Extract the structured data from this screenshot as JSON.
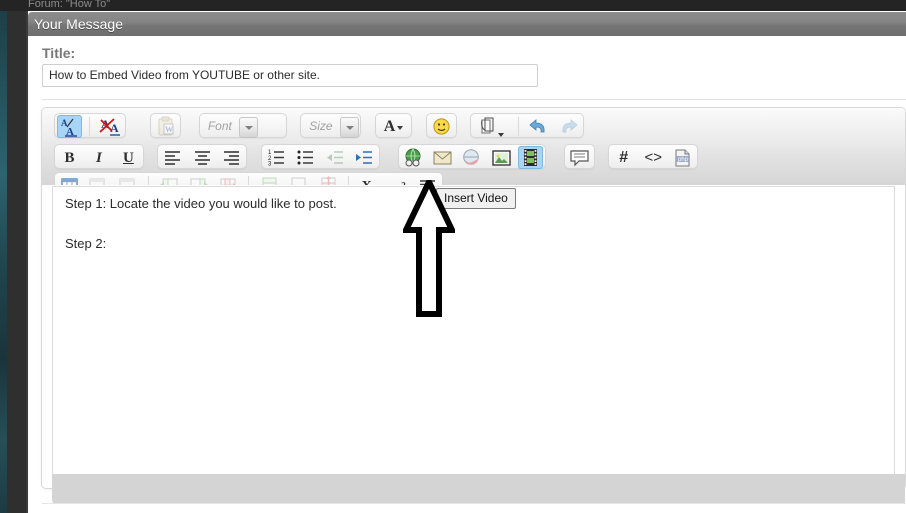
{
  "window": {
    "breadcrumb": "Forum: \"How To\"",
    "panel_header": "Your Message"
  },
  "title_field": {
    "label": "Title:",
    "value": "How to Embed Video from YOUTUBE or other site.",
    "placeholder": ""
  },
  "editor": {
    "body_text": "Step 1: Locate the video you would like to post.\n\nStep 2:",
    "tooltip": "Insert Video",
    "colors": {
      "active_button": "#a8d4f5",
      "toolbar_top": "#fbfbfb",
      "toolbar_bottom": "#d6d6d6",
      "status_bar": "#d4d4d4",
      "header_grey": "#838383",
      "left_rail_teal": "#2c6470",
      "left_rail_dark": "#2f2f2f"
    },
    "toolbar_rows": [
      {
        "row": 1,
        "groups": [
          {
            "items": [
              {
                "name": "spellcheck-icon",
                "glyph": "A/A",
                "state": "active"
              },
              {
                "name": "remove-format-icon",
                "glyph": "A",
                "state": "normal"
              }
            ]
          },
          {
            "items": [
              {
                "name": "paste-from-word-icon",
                "glyph": "W",
                "state": "disabled"
              }
            ]
          },
          {
            "items": [
              {
                "name": "font-family-dropdown",
                "glyph": "Font",
                "state": "disabled"
              }
            ]
          },
          {
            "items": [
              {
                "name": "font-size-dropdown",
                "glyph": "Size",
                "state": "disabled"
              }
            ]
          },
          {
            "items": [
              {
                "name": "text-color-icon",
                "glyph": "A",
                "state": "normal"
              }
            ]
          },
          {
            "items": [
              {
                "name": "emoticon-icon",
                "glyph": "smiley",
                "state": "normal"
              }
            ]
          },
          {
            "items": [
              {
                "name": "attachment-icon",
                "glyph": "clip",
                "state": "normal"
              },
              {
                "name": "undo-icon",
                "glyph": "undo",
                "state": "normal"
              },
              {
                "name": "redo-icon",
                "glyph": "redo",
                "state": "disabled"
              }
            ]
          }
        ]
      },
      {
        "row": 2,
        "groups": [
          {
            "items": [
              {
                "name": "bold-icon",
                "glyph": "B",
                "state": "normal"
              },
              {
                "name": "italic-icon",
                "glyph": "I",
                "state": "normal"
              },
              {
                "name": "underline-icon",
                "glyph": "U",
                "state": "normal"
              }
            ]
          },
          {
            "items": [
              {
                "name": "align-left-icon",
                "glyph": "align-left",
                "state": "normal"
              },
              {
                "name": "align-center-icon",
                "glyph": "align-center",
                "state": "normal"
              },
              {
                "name": "align-right-icon",
                "glyph": "align-right",
                "state": "normal"
              }
            ]
          },
          {
            "items": [
              {
                "name": "ordered-list-icon",
                "glyph": "ol",
                "state": "normal"
              },
              {
                "name": "unordered-list-icon",
                "glyph": "ul",
                "state": "normal"
              },
              {
                "name": "outdent-icon",
                "glyph": "outdent",
                "state": "disabled"
              },
              {
                "name": "indent-icon",
                "glyph": "indent",
                "state": "normal"
              }
            ]
          },
          {
            "items": [
              {
                "name": "insert-link-icon",
                "glyph": "globe",
                "state": "normal"
              },
              {
                "name": "insert-email-icon",
                "glyph": "envelope",
                "state": "normal"
              },
              {
                "name": "remove-link-icon",
                "glyph": "globe-broken",
                "state": "normal"
              },
              {
                "name": "insert-image-icon",
                "glyph": "picture",
                "state": "normal"
              },
              {
                "name": "insert-video-icon",
                "glyph": "film",
                "state": "active"
              }
            ]
          },
          {
            "items": [
              {
                "name": "insert-quote-icon",
                "glyph": "speech-bubble",
                "state": "normal"
              }
            ]
          },
          {
            "items": [
              {
                "name": "insert-code-icon",
                "glyph": "#",
                "state": "normal"
              },
              {
                "name": "insert-html-icon",
                "glyph": "<>",
                "state": "normal"
              },
              {
                "name": "insert-php-icon",
                "glyph": "php",
                "state": "normal"
              }
            ]
          }
        ]
      },
      {
        "row": 3,
        "groups": [
          {
            "items": [
              {
                "name": "insert-table-icon",
                "glyph": "table",
                "state": "normal"
              },
              {
                "name": "table-properties-icon",
                "glyph": "table-props",
                "state": "disabled"
              },
              {
                "name": "delete-table-icon",
                "glyph": "table-delete",
                "state": "disabled"
              },
              {
                "name": "insert-column-before-icon",
                "glyph": "col-before",
                "state": "disabled"
              },
              {
                "name": "insert-column-after-icon",
                "glyph": "col-after",
                "state": "disabled"
              },
              {
                "name": "delete-column-icon",
                "glyph": "col-delete",
                "state": "disabled"
              },
              {
                "name": "insert-row-before-icon",
                "glyph": "row-before",
                "state": "disabled"
              },
              {
                "name": "insert-row-after-icon",
                "glyph": "row-after",
                "state": "disabled"
              },
              {
                "name": "delete-row-icon",
                "glyph": "row-delete",
                "state": "disabled"
              },
              {
                "name": "subscript-icon",
                "glyph": "X2",
                "state": "normal"
              },
              {
                "name": "superscript-icon",
                "glyph": "X2",
                "state": "normal"
              },
              {
                "name": "horizontal-rule-icon",
                "glyph": "hr",
                "state": "normal"
              }
            ]
          }
        ]
      }
    ]
  },
  "annotation": {
    "type": "arrow",
    "direction": "up",
    "color": "#000000",
    "points_at": "insert-video-icon"
  }
}
